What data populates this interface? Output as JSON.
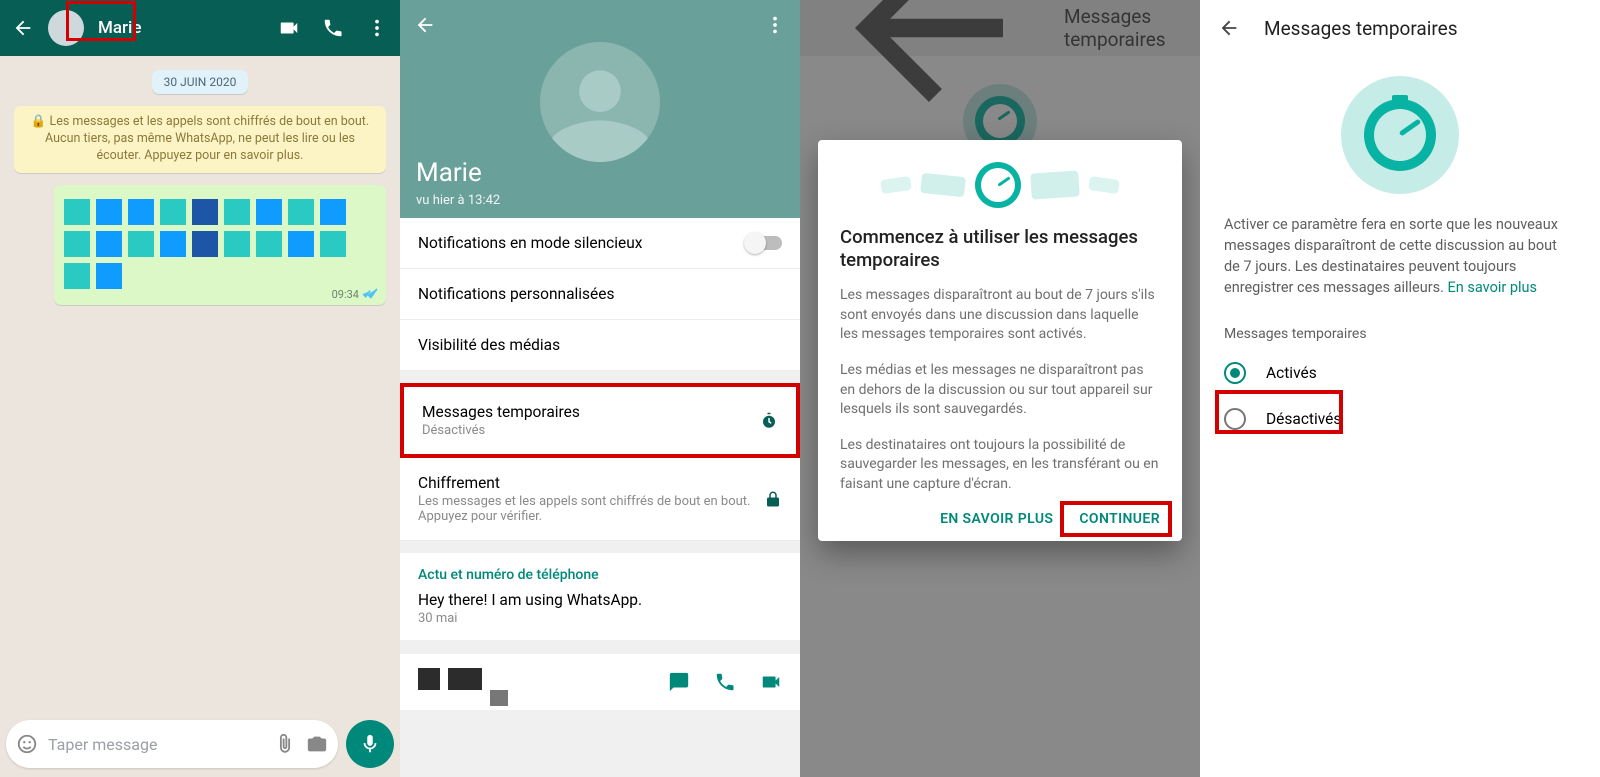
{
  "p1": {
    "contact": "Marie",
    "date_pill": "30 JUIN 2020",
    "encryption_note": "🔒 Les messages et les appels sont chiffrés de bout en bout. Aucun tiers, pas même WhatsApp, ne peut les lire ou les écouter. Appuyez pour en savoir plus.",
    "msg_time": "09:34",
    "composer_placeholder": "Taper message"
  },
  "p2": {
    "name": "Marie",
    "last_seen": "vu hier à 13:42",
    "rows": {
      "mute": "Notifications en mode silencieux",
      "custom": "Notifications personnalisées",
      "media": "Visibilité des médias",
      "disappearing": "Messages temporaires",
      "disappearing_sub": "Désactivés",
      "encryption": "Chiffrement",
      "encryption_sub": "Les messages et les appels sont chiffrés de bout en bout. Appuyez pour vérifier.",
      "section_title": "Actu et numéro de téléphone",
      "status": "Hey there! I am using WhatsApp.",
      "status_date": "30 mai"
    }
  },
  "p3": {
    "header": "Messages temporaires",
    "title": "Commencez à utiliser les messages temporaires",
    "para1": "Les messages disparaîtront au bout de 7 jours s'ils sont envoyés dans une discussion dans laquelle les messages temporaires sont activés.",
    "para2": "Les médias et les messages ne disparaîtront pas en dehors de la discussion ou sur tout appareil sur lesquels ils sont sauvegardés.",
    "para3": "Les destinataires ont toujours la possibilité de sauvegarder les messages, en les transférant ou en faisant une capture d'écran.",
    "learn_more": "EN SAVOIR PLUS",
    "continue": "CONTINUER"
  },
  "p4": {
    "header": "Messages temporaires",
    "desc": "Activer ce paramètre fera en sorte que les nouveaux messages disparaîtront de cette discussion au bout de 7 jours. Les destinataires peuvent toujours enregistrer ces messages ailleurs. ",
    "learn_more": "En savoir plus",
    "section": "Messages temporaires",
    "opt_on": "Activés",
    "opt_off": "Désactivés"
  }
}
